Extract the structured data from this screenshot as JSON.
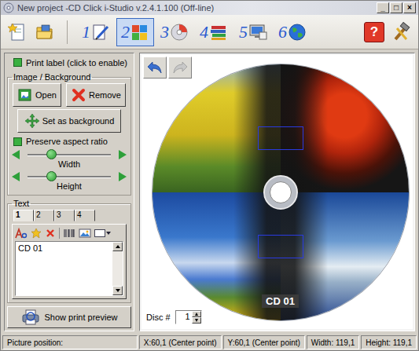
{
  "window": {
    "title": "New project -CD Click i-Studio v.2.4.1.100 (Off-line)",
    "controls": [
      "_",
      "□",
      "×"
    ]
  },
  "toolbar": {
    "steps": [
      {
        "label": "1",
        "selected": false
      },
      {
        "label": "2",
        "selected": true
      },
      {
        "label": "3",
        "selected": false
      },
      {
        "label": "4",
        "selected": false
      },
      {
        "label": "5",
        "selected": false
      },
      {
        "label": "6",
        "selected": false
      }
    ],
    "help": "?"
  },
  "left_panel": {
    "print_label": {
      "label": "Print label (click to enable)",
      "checked": true
    },
    "image_group": {
      "title": "Image / Background",
      "buttons": [
        {
          "label": "Open"
        },
        {
          "label": "Remove"
        }
      ],
      "set_background": "Set as background",
      "preserve_aspect": {
        "label": "Preserve aspect ratio",
        "checked": true
      },
      "sliders": [
        {
          "label": "Width",
          "level": 0.28
        },
        {
          "label": "Height",
          "level": 0.28
        }
      ]
    },
    "text_group": {
      "title": "Text",
      "tabs": [
        {
          "label": "1",
          "selected": true
        },
        {
          "label": "2",
          "selected": false
        },
        {
          "label": "3",
          "selected": false
        },
        {
          "label": "4",
          "selected": false
        }
      ],
      "content": "CD 01"
    },
    "preview_button": "Show print preview"
  },
  "canvas": {
    "disc_text": "CD 01",
    "disc_number": {
      "label": "Disc #",
      "value": "1"
    }
  },
  "status_bar": [
    "Picture position:",
    "X:60,1 (Center point)",
    "Y:60,1 (Center point)",
    "Width: 119,1",
    "Height: 119,1"
  ]
}
